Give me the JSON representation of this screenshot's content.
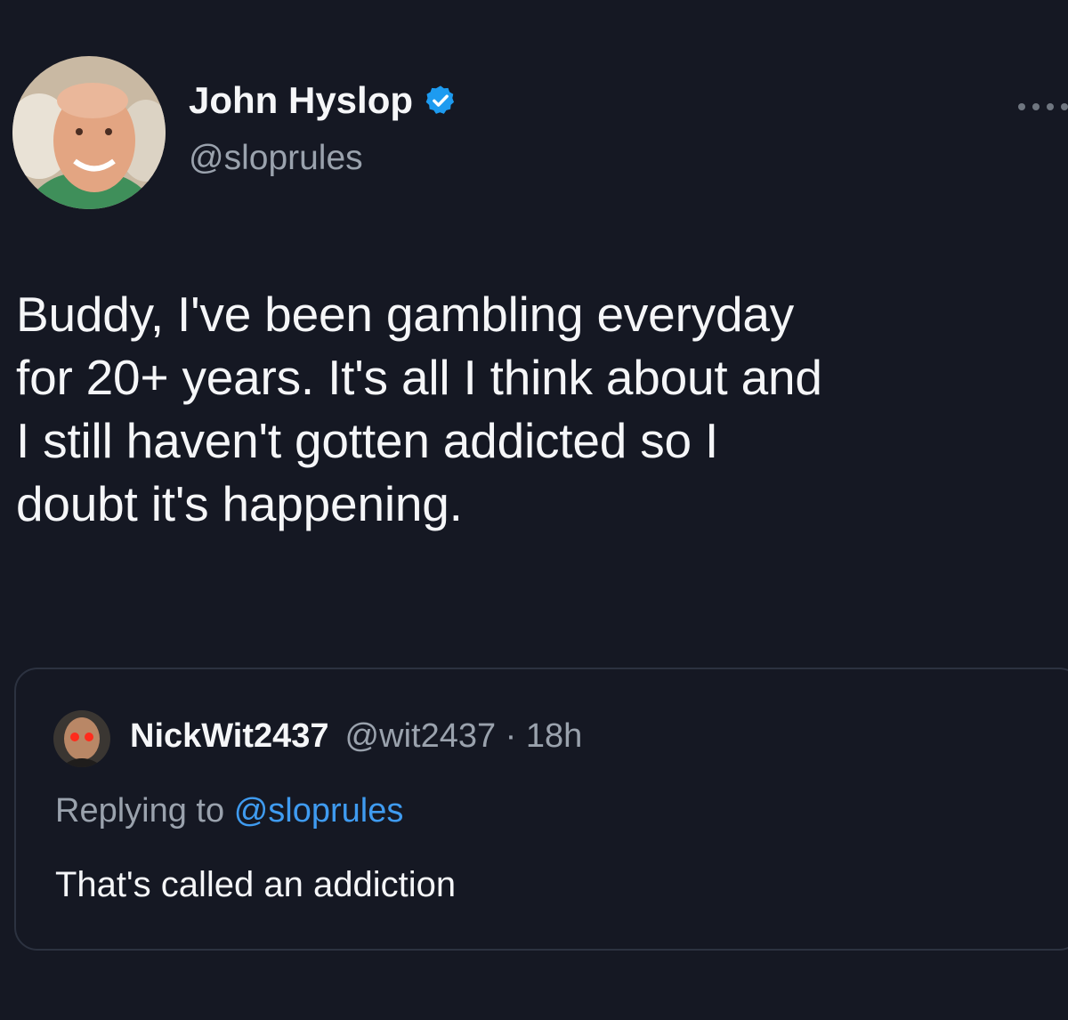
{
  "tweet": {
    "author": {
      "display_name": "John Hyslop",
      "handle": "@sloprules",
      "verified_icon": "verified-badge-icon"
    },
    "text": "Buddy, I've been gambling everyday\nfor 20+ years. It's all I think about and\nI still haven't gotten addicted so I\ndoubt it's happening."
  },
  "quoted": {
    "author": {
      "display_name": "NickWit2437",
      "handle": "@wit2437",
      "separator": "·",
      "time": "18h"
    },
    "reply_prefix": "Replying to",
    "reply_mention": "@sloprules",
    "text": "That's called an addiction"
  },
  "colors": {
    "background": "#151823",
    "text": "#f5f6f8",
    "muted": "#9aa2ad",
    "link": "#3f9bf0",
    "verified": "#1d9bf0",
    "border": "#2c3240"
  }
}
